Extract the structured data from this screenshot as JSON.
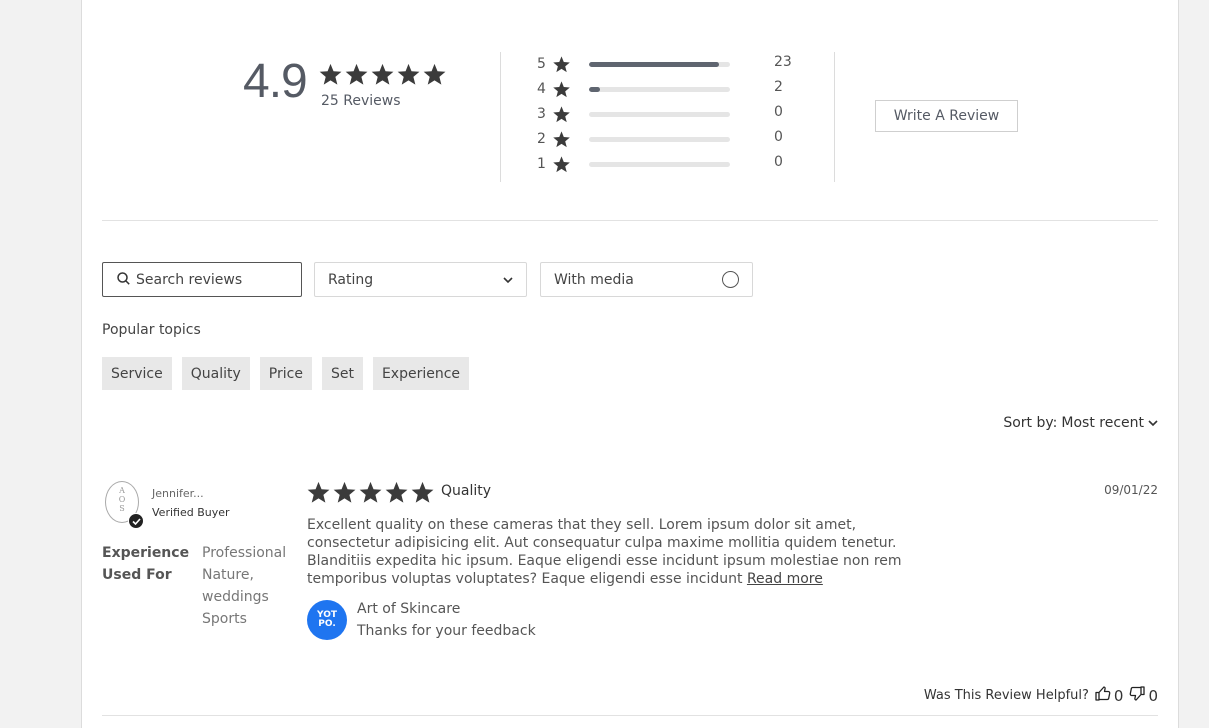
{
  "summary": {
    "average": "4.9",
    "review_count_label": "25 Reviews",
    "distribution": [
      {
        "stars": "5",
        "count": "23",
        "fraction": 0.92
      },
      {
        "stars": "4",
        "count": "2",
        "fraction": 0.08
      },
      {
        "stars": "3",
        "count": "0",
        "fraction": 0
      },
      {
        "stars": "2",
        "count": "0",
        "fraction": 0
      },
      {
        "stars": "1",
        "count": "0",
        "fraction": 0
      }
    ],
    "write_review_label": "Write A Review"
  },
  "filters": {
    "search_placeholder": "Search reviews",
    "rating_label": "Rating",
    "media_label": "With media",
    "popular_topics_label": "Popular topics",
    "topics": [
      "Service",
      "Quality",
      "Price",
      "Set",
      "Experience"
    ]
  },
  "sort": {
    "label": "Sort by:",
    "value": "Most recent"
  },
  "review": {
    "avatar_text": "A O S",
    "reviewer_name": "Jennifer...",
    "verified_label": "Verified Buyer",
    "attribute_label_1": "Experience",
    "attribute_label_2": "Used For",
    "attribute_values": [
      "Professional",
      "Nature,",
      "weddings",
      "Sports"
    ],
    "rating": 5,
    "title": "Quality",
    "date": "09/01/22",
    "body": "Excellent quality on these cameras that they sell. Lorem ipsum dolor sit amet, consectetur adipisicing elit. Aut consequatur culpa maxime mollitia quidem tenetur. Blanditiis expedita hic ipsum. Eaque eligendi esse incidunt ipsum molestiae non rem temporibus voluptas voluptates? Eaque eligendi esse incidunt",
    "read_more_label": "Read more",
    "reply_logo_text": "YOT PO.",
    "reply_name": "Art of Skincare",
    "reply_text": "Thanks for your feedback",
    "helpful_label": "Was This Review Helpful?",
    "upvotes": "0",
    "downvotes": "0"
  },
  "colors": {
    "accent_blue": "#1f75f0",
    "star": "#3b3b3b",
    "bar_fill": "#5f6570"
  }
}
